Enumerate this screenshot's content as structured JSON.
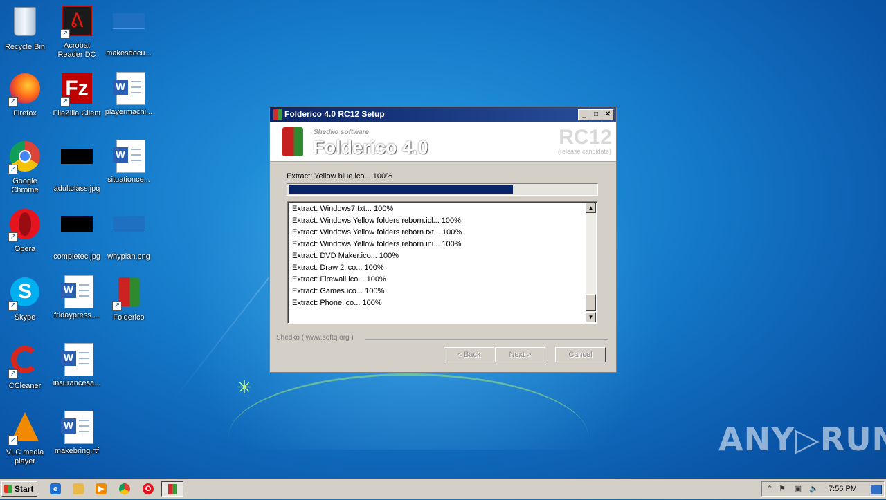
{
  "desktop": {
    "icons": [
      {
        "label": "Recycle Bin",
        "icon": "recycle-bin-icon"
      },
      {
        "label": "Acrobat Reader DC",
        "icon": "acrobat-icon"
      },
      {
        "label": "makesdocu...",
        "icon": "image-file-icon"
      },
      {
        "label": "Firefox",
        "icon": "firefox-icon"
      },
      {
        "label": "FileZilla Client",
        "icon": "filezilla-icon"
      },
      {
        "label": "playermachi...",
        "icon": "word-doc-icon"
      },
      {
        "label": "Google Chrome",
        "icon": "chrome-icon"
      },
      {
        "label": "adultclass.jpg",
        "icon": "image-file-icon"
      },
      {
        "label": "situationce...",
        "icon": "word-doc-icon"
      },
      {
        "label": "Opera",
        "icon": "opera-icon"
      },
      {
        "label": "completec.jpg",
        "icon": "image-file-icon"
      },
      {
        "label": "whyplan.png",
        "icon": "image-file-icon"
      },
      {
        "label": "Skype",
        "icon": "skype-icon"
      },
      {
        "label": "fridaypress....",
        "icon": "word-doc-icon"
      },
      {
        "label": "Folderico",
        "icon": "folderico-icon"
      },
      {
        "label": "CCleaner",
        "icon": "ccleaner-icon"
      },
      {
        "label": "insurancesa...",
        "icon": "word-doc-icon"
      },
      {
        "label": "VLC media player",
        "icon": "vlc-icon"
      },
      {
        "label": "makebring.rtf",
        "icon": "word-doc-icon"
      }
    ]
  },
  "dialog": {
    "title": "Folderico 4.0 RC12 Setup",
    "vendor": "Shedko software",
    "product": "Folderico 4.0",
    "release": "RC12",
    "release_sub": "(release candidate)",
    "status": "Extract: Yellow blue.ico... 100%",
    "progress_fraction": 0.73,
    "log": [
      "Extract: Windows7.txt... 100%",
      "Extract: Windows Yellow folders reborn.icl... 100%",
      "Extract: Windows Yellow folders reborn.txt... 100%",
      "Extract: Windows Yellow folders reborn.ini... 100%",
      "Extract: DVD Maker.ico... 100%",
      "Extract: Draw 2.ico... 100%",
      "Extract: Firewall.ico... 100%",
      "Extract: Games.ico... 100%",
      "Extract: Phone.ico... 100%"
    ],
    "brand_line": "Shedko ( www.softq.org )",
    "buttons": {
      "back": "< Back",
      "next": "Next >",
      "cancel": "Cancel"
    }
  },
  "taskbar": {
    "start": "Start",
    "clock": "7:56 PM"
  },
  "watermark": "ANY▷RUN",
  "colors": {
    "title_bar": "#0a246a",
    "progress": "#0a246a",
    "desktop": "#1478c8"
  }
}
